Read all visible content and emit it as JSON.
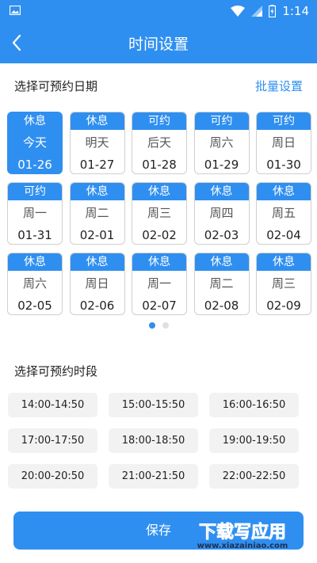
{
  "status_bar": {
    "time": "1:14"
  },
  "header": {
    "title": "时间设置"
  },
  "date_section": {
    "title": "选择可预约日期",
    "batch_label": "批量设置"
  },
  "dates": [
    {
      "status": "休息",
      "week": "今天",
      "day": "01-26",
      "selected": true
    },
    {
      "status": "休息",
      "week": "明天",
      "day": "01-27",
      "selected": false
    },
    {
      "status": "可约",
      "week": "后天",
      "day": "01-28",
      "selected": false
    },
    {
      "status": "可约",
      "week": "周六",
      "day": "01-29",
      "selected": false
    },
    {
      "status": "可约",
      "week": "周日",
      "day": "01-30",
      "selected": false
    },
    {
      "status": "可约",
      "week": "周一",
      "day": "01-31",
      "selected": false
    },
    {
      "status": "休息",
      "week": "周二",
      "day": "02-01",
      "selected": false
    },
    {
      "status": "休息",
      "week": "周三",
      "day": "02-02",
      "selected": false
    },
    {
      "status": "休息",
      "week": "周四",
      "day": "02-03",
      "selected": false
    },
    {
      "status": "休息",
      "week": "周五",
      "day": "02-04",
      "selected": false
    },
    {
      "status": "休息",
      "week": "周六",
      "day": "02-05",
      "selected": false
    },
    {
      "status": "休息",
      "week": "周日",
      "day": "02-06",
      "selected": false
    },
    {
      "status": "休息",
      "week": "周一",
      "day": "02-07",
      "selected": false
    },
    {
      "status": "休息",
      "week": "周二",
      "day": "02-08",
      "selected": false
    },
    {
      "status": "休息",
      "week": "周三",
      "day": "02-09",
      "selected": false
    }
  ],
  "pager": {
    "pages": 2,
    "current": 1
  },
  "time_section": {
    "title": "选择可预约时段"
  },
  "slots": [
    "14:00-14:50",
    "15:00-15:50",
    "16:00-16:50",
    "17:00-17:50",
    "18:00-18:50",
    "19:00-19:50",
    "20:00-20:50",
    "21:00-21:50",
    "22:00-22:50"
  ],
  "save_button": {
    "label": "保存"
  },
  "watermark": {
    "main": "下载写应用",
    "url": "www.xiazainiao.com"
  },
  "colors": {
    "accent": "#2f8ff0",
    "slot_bg": "#f2f2f2"
  }
}
